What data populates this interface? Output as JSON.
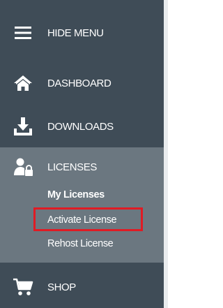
{
  "menu": {
    "hide_label": "HIDE MENU",
    "dashboard_label": "DASHBOARD",
    "downloads_label": "DOWNLOADS",
    "licenses_label": "LICENSES",
    "shop_label": "SHOP"
  },
  "licenses_submenu": {
    "items": [
      "My Licenses",
      "Activate License",
      "Rehost License"
    ],
    "active": "My Licenses",
    "highlighted": "Activate License"
  },
  "colors": {
    "sidebar_bg": "#3f4c57",
    "expanded_section_bg": "#6b7780",
    "highlight_border": "#e01b24",
    "text": "#ffffff"
  },
  "icons": {
    "hide": "hamburger-icon",
    "dashboard": "home-icon",
    "downloads": "download-tray-icon",
    "licenses": "user-lock-icon",
    "shop": "shopping-cart-icon"
  }
}
